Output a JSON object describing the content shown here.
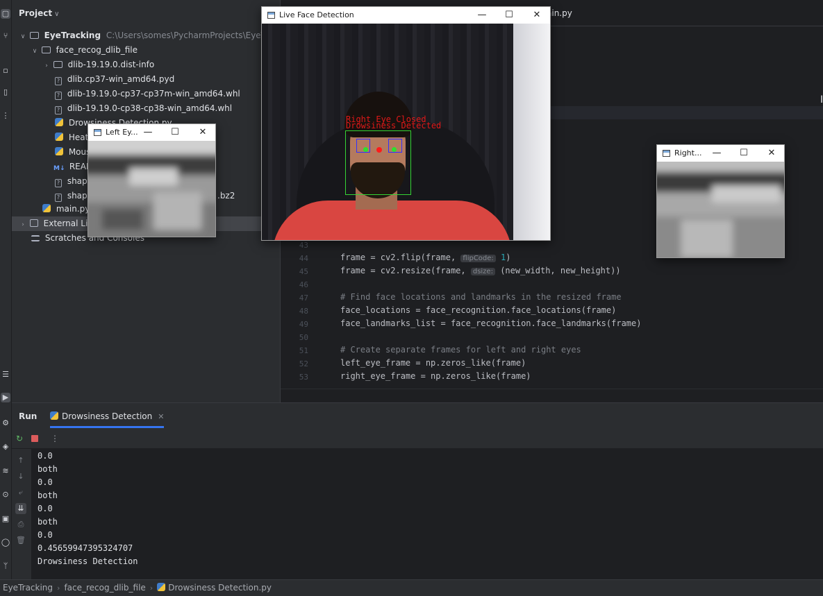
{
  "project_panel": {
    "title": "Project",
    "tree": [
      {
        "name": "EyeTracking",
        "path": "C:\\Users\\somes\\PycharmProjects\\EyeTrackin"
      },
      {
        "name": "face_recog_dlib_file"
      },
      {
        "name": "dlib-19.19.0.dist-info"
      },
      {
        "name": "dlib.cp37-win_amd64.pyd"
      },
      {
        "name": "dlib-19.19.0-cp37-cp37m-win_amd64.whl"
      },
      {
        "name": "dlib-19.19.0-cp38-cp38-win_amd64.whl"
      },
      {
        "name": "Drowsiness Detection.py"
      },
      {
        "name": "Heat M"
      },
      {
        "name": "Mouse"
      },
      {
        "name": "READM"
      },
      {
        "name": "shape"
      },
      {
        "name": "shape",
        "suffix": ".bz2"
      },
      {
        "name": "main.py"
      },
      {
        "name": "External Libraries"
      },
      {
        "name": "Scratches and Consoles"
      }
    ]
  },
  "editor": {
    "tab": "ain.py",
    "lines": [
      {
        "no": "43",
        "text": ""
      },
      {
        "no": "44",
        "before": "frame = cv2.flip(frame, ",
        "hint": "flipCode:",
        "value": "1",
        "after": ")"
      },
      {
        "no": "45",
        "before": "frame = cv2.resize(frame, ",
        "hint": "dsize:",
        "after": "(new_width, new_height))"
      },
      {
        "no": "46",
        "text": ""
      },
      {
        "no": "47",
        "comment": "# Find face locations and landmarks in the resized frame"
      },
      {
        "no": "48",
        "text": "face_locations = face_recognition.face_locations(frame)"
      },
      {
        "no": "49",
        "text": "face_landmarks_list = face_recognition.face_landmarks(frame)"
      },
      {
        "no": "50",
        "text": ""
      },
      {
        "no": "51",
        "comment": "# Create separate frames for left and right eyes"
      },
      {
        "no": "52",
        "text": "left_eye_frame = np.zeros_like(frame)"
      },
      {
        "no": "53",
        "text": "right_eye_frame = np.zeros_like(frame)"
      }
    ]
  },
  "run_panel": {
    "title": "Run",
    "tab": "Drowsiness Detection",
    "output": [
      "0.0",
      "both",
      "0.0",
      "both",
      "0.0",
      "both",
      "0.0",
      "0.45659947395324707",
      "Drowsiness Detection"
    ]
  },
  "windows": {
    "live": {
      "title": "Live Face Detection",
      "overlay_line1": "Right Eye Closed",
      "overlay_line2": "Drowsiness Detected",
      "overlay_color": "#e01818",
      "face_box_color": "#35d535",
      "eye_box_color": "#3030ff"
    },
    "left_eye": {
      "title": "Left Ey..."
    },
    "right_eye": {
      "title": "Right..."
    }
  },
  "window_controls": {
    "minimize": "—",
    "maximize": "☐",
    "close": "✕"
  },
  "status_bar": {
    "crumbs": [
      "EyeTracking",
      "face_recog_dlib_file",
      "Drowsiness Detection.py"
    ]
  },
  "colors": {
    "ide_bg": "#1e1f22",
    "panel_bg": "#2b2d30",
    "accent": "#3574f0"
  }
}
